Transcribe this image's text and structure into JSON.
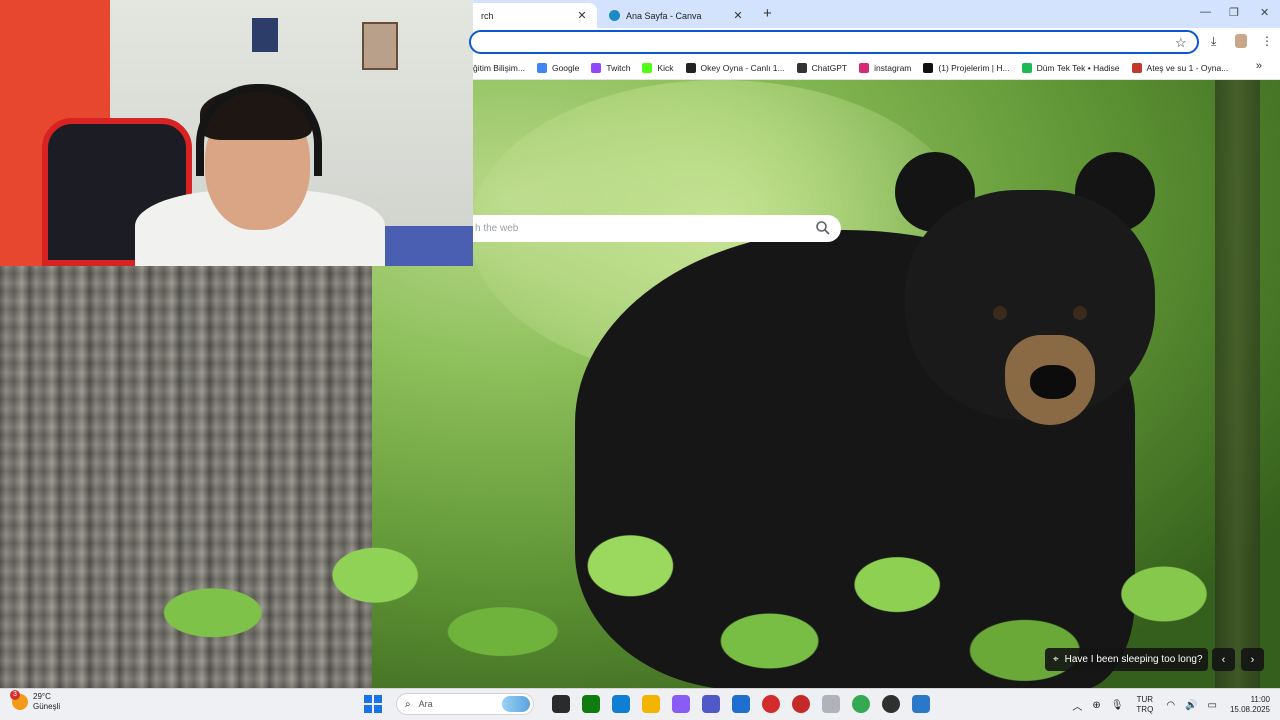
{
  "browser": {
    "tabs": [
      {
        "title": "rch",
        "active": true
      },
      {
        "title": "Ana Sayfa - Canva",
        "active": false
      }
    ],
    "tab_close_glyph": "✕",
    "new_tab_glyph": "+",
    "bookmarks": [
      {
        "label": "ğitim Bilişim...",
        "icon": "folder-icon",
        "color": "#fbbc04"
      },
      {
        "label": "Google",
        "icon": "google-icon",
        "color": "#4285f4"
      },
      {
        "label": "Twitch",
        "icon": "twitch-icon",
        "color": "#9146ff"
      },
      {
        "label": "Kick",
        "icon": "kick-icon",
        "color": "#53fc18"
      },
      {
        "label": "Okey Oyna - Canlı 1...",
        "icon": "okey-icon",
        "color": "#222222"
      },
      {
        "label": "ChatGPT",
        "icon": "chatgpt-icon",
        "color": "#333333"
      },
      {
        "label": "instagram",
        "icon": "instagram-icon",
        "color": "#d62976"
      },
      {
        "label": "(1) Projelerim | H...",
        "icon": "project-icon",
        "color": "#111111"
      },
      {
        "label": "Düm Tek Tek • Hadise",
        "icon": "music-icon",
        "color": "#1db954"
      },
      {
        "label": "Ateş ve su 1 - Oyna...",
        "icon": "game-icon",
        "color": "#c0392b"
      }
    ]
  },
  "newtab": {
    "search_placeholder": "h the web"
  },
  "wallpaper": {
    "caption": "Have I been sleeping too long?"
  },
  "taskbar": {
    "weather_temp": "29°C",
    "weather_desc": "Güneşli",
    "weather_badge": "3",
    "search_placeholder": "Ara",
    "lang_top": "TUR",
    "lang_bottom": "TRQ",
    "time": "11:00",
    "date": "15.08.2025",
    "apps": [
      {
        "name": "task-view-icon",
        "color": "#2b2b2b"
      },
      {
        "name": "xbox-icon",
        "color": "#107c10"
      },
      {
        "name": "edge-icon",
        "color": "#0f7fd6"
      },
      {
        "name": "file-explorer-icon",
        "color": "#f4b400"
      },
      {
        "name": "copilot-icon",
        "color": "#8a5cf6"
      },
      {
        "name": "teams-icon",
        "color": "#5059c9"
      },
      {
        "name": "store-icon",
        "color": "#1f6fd0"
      },
      {
        "name": "app-red-1-icon",
        "color": "#d22b2b"
      },
      {
        "name": "app-red-2-icon",
        "color": "#c62828"
      },
      {
        "name": "app-gray-icon",
        "color": "#b0b4ba"
      },
      {
        "name": "chrome-icon",
        "color": "#34a853"
      },
      {
        "name": "obs-icon",
        "color": "#303030"
      },
      {
        "name": "app-blue-icon",
        "color": "#2a78c8"
      }
    ]
  }
}
